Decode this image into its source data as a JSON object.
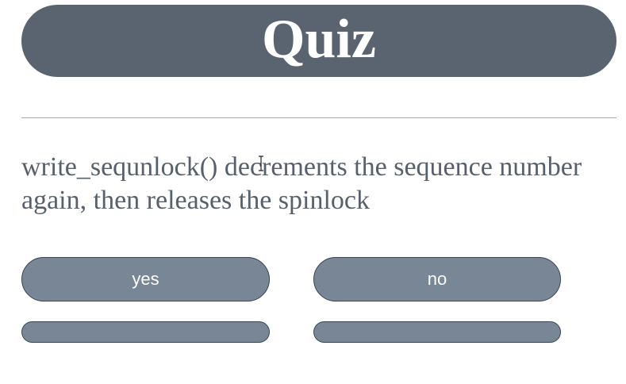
{
  "header": {
    "title": "Quiz"
  },
  "question": {
    "text": "write_sequnlock() decrements the sequence number again, then releases the spinlock"
  },
  "answers": {
    "yes_label": "yes",
    "no_label": "no"
  },
  "colors": {
    "title_bar": "#5a6470",
    "button": "#788696",
    "button_border": "#3a4452",
    "question_text": "#58606b"
  },
  "icons": {
    "cursor": "text-cursor-icon"
  }
}
